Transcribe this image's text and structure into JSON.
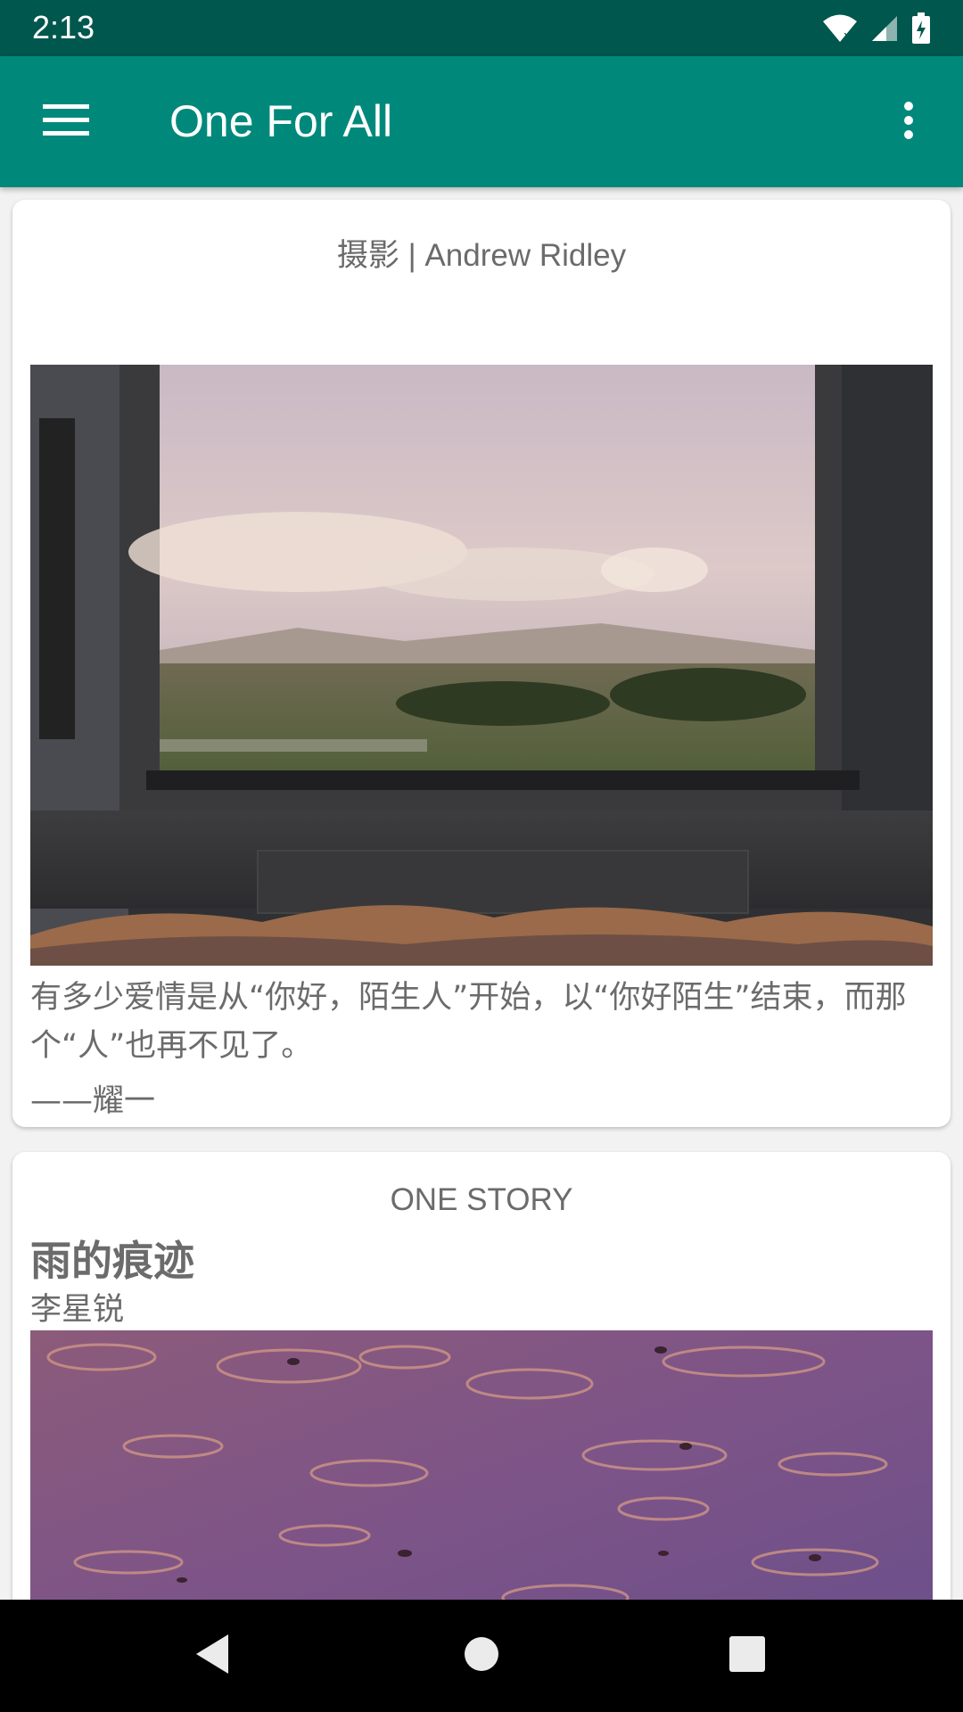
{
  "status_bar": {
    "time": "2:13"
  },
  "app_bar": {
    "title": "One For All"
  },
  "cards": [
    {
      "subtitle": "摄影 | Andrew Ridley",
      "image": "window-landscape-photo",
      "quote": "有多少爱情是从“你好，陌生人”开始，以“你好陌生”结束，而那个“人”也再不见了。",
      "author": "——耀一"
    },
    {
      "category": "ONE STORY",
      "title": "雨的痕迹",
      "author": "李星锐",
      "image": "rain-ripples-photo"
    }
  ],
  "icons": {
    "menu": "hamburger-menu-icon",
    "overflow": "more-vert-icon",
    "wifi": "wifi-icon",
    "signal": "signal-icon",
    "battery": "battery-charging-icon",
    "nav_back": "back-icon",
    "nav_home": "home-icon",
    "nav_recents": "recents-icon"
  },
  "colors": {
    "status_bar": "#00574e",
    "app_bar": "#00897b",
    "card_text": "#6b6b6b"
  }
}
